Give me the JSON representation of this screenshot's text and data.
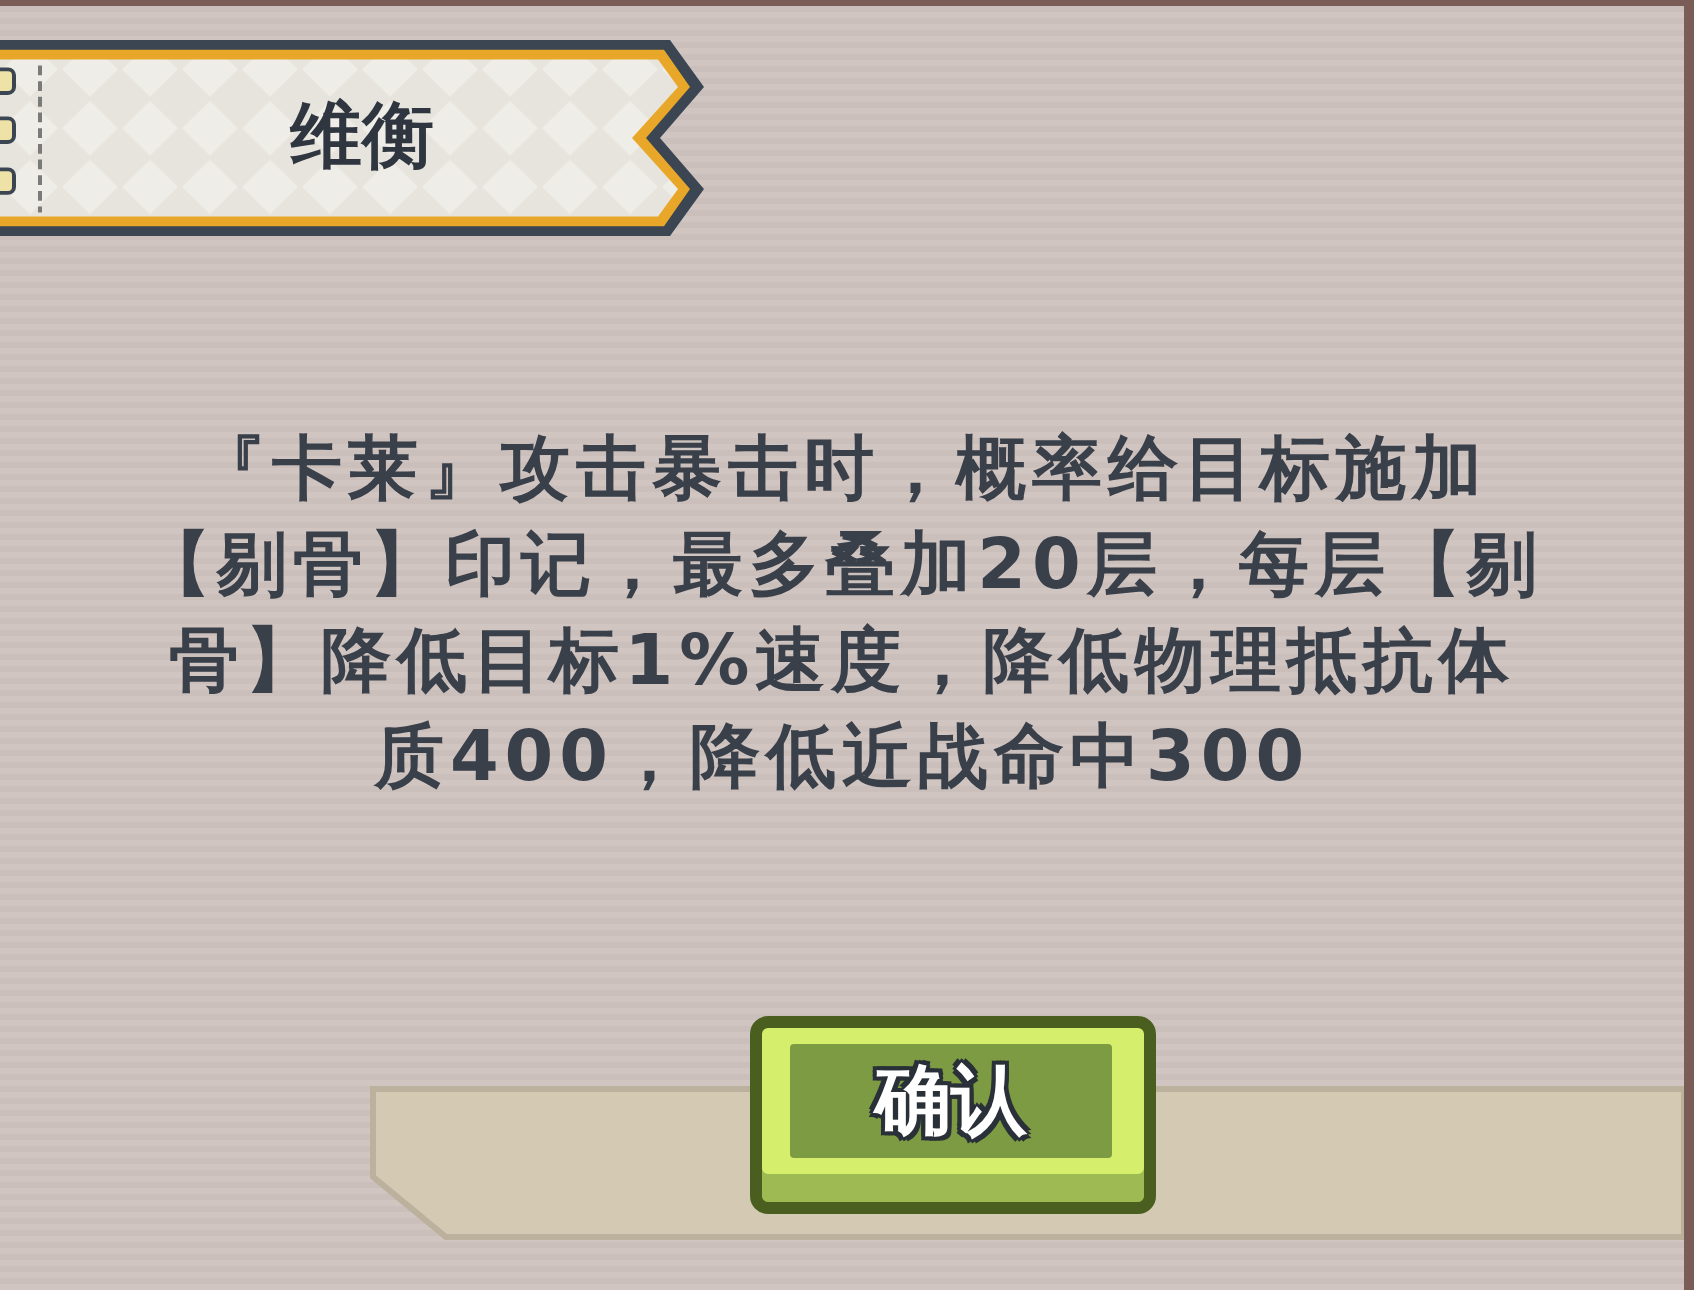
{
  "dialog": {
    "title": "维衡",
    "description": "『卡莱』攻击暴击时，概率给目标施加【剔骨】印记，最多叠加20层，每层【剔骨】降低目标1%速度，降低物理抵抗体质400，降低近战命中300"
  },
  "buttons": [
    {
      "label": "确认",
      "kind": "primary"
    }
  ]
}
